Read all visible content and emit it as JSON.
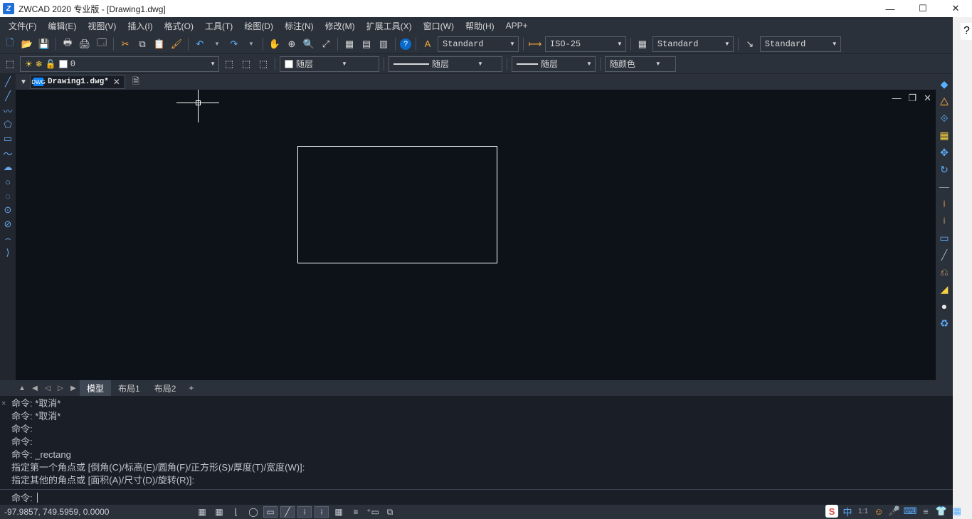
{
  "title": "ZWCAD 2020 专业版 - [Drawing1.dwg]",
  "window": {
    "min": "—",
    "max": "☐",
    "close": "✕"
  },
  "help_hint": "?",
  "menu": [
    "文件(F)",
    "编辑(E)",
    "视图(V)",
    "插入(I)",
    "格式(O)",
    "工具(T)",
    "绘图(D)",
    "标注(N)",
    "修改(M)",
    "扩展工具(X)",
    "窗口(W)",
    "帮助(H)",
    "APP+"
  ],
  "tb1": {
    "new": "🗋",
    "open": "📂",
    "save": "💾",
    "print": "🖶",
    "plot": "🖨",
    "preview": "🗔",
    "cut": "✂",
    "copy": "⧉",
    "paste": "📋",
    "match": "🖌",
    "undo": "↶",
    "redo": "↷",
    "pan": "✋",
    "zoomin": "⊕",
    "zoomwin": "🔍",
    "zoomext": "⤢",
    "grid1": "▦",
    "grid2": "▤",
    "grid3": "▥",
    "help": "?",
    "textstyle_icon": "A",
    "textstyle": "Standard",
    "dimstyle_icon": "⟼",
    "dimstyle": "ISO-25",
    "tablestyle_icon": "▦",
    "tablestyle": "Standard",
    "leader_icon": "↘",
    "leader": "Standard"
  },
  "tb2": {
    "layer_icons": [
      "☀",
      "❄",
      "🔓",
      "▭"
    ],
    "layer_name": "0",
    "layerctl1": "⬚",
    "layerctl2": "⬚",
    "layerctl3": "⬚",
    "color_label": "随层",
    "linetype_label": "随层",
    "lineweight_label": "随层",
    "plotstyle_label": "随颜色"
  },
  "docs": {
    "tabmarker": "▼",
    "tab_icon": "DWG",
    "tab_name": "Drawing1.dwg*",
    "tab_close": "✕",
    "new_icon": "🗎"
  },
  "viewctrl": {
    "min": "—",
    "restore": "❐",
    "close": "✕"
  },
  "left_tools": [
    "╱",
    "╱",
    "〰",
    "⬠",
    "▭",
    "〜",
    "☁",
    "○",
    "◌",
    "⊙",
    "⊘",
    "⌢",
    "⟩"
  ],
  "right_tools": [
    {
      "g": "◆",
      "c": "blue"
    },
    {
      "g": "⧋",
      "c": "orange"
    },
    {
      "g": "⟐",
      "c": "blue"
    },
    {
      "g": "▦",
      "c": "yellow"
    },
    {
      "g": "✥",
      "c": "blue"
    },
    {
      "g": "↻",
      "c": "blue"
    },
    {
      "g": "—",
      "c": "gray"
    },
    {
      "g": "⟊",
      "c": "orange"
    },
    {
      "g": "⟊",
      "c": "tan"
    },
    {
      "g": "▭",
      "c": "blue"
    },
    {
      "g": "╱",
      "c": "gray"
    },
    {
      "g": "⎌",
      "c": "tan"
    },
    {
      "g": "◢",
      "c": "yellow"
    },
    {
      "g": "●",
      "c": "white"
    },
    {
      "g": "♻",
      "c": "blue"
    }
  ],
  "layout": {
    "nav": [
      "▲",
      "◀",
      "◁",
      "▷",
      "▶"
    ],
    "tabs": [
      "模型",
      "布局1",
      "布局2"
    ],
    "add": "+"
  },
  "cmd": {
    "lines": [
      "命令: *取消*",
      "命令: *取消*",
      "命令:",
      "命令:",
      "命令: _rectang",
      "指定第一个角点或 [倒角(C)/标高(E)/圆角(F)/正方形(S)/厚度(T)/宽度(W)]:",
      "指定其他的角点或 [面积(A)/尺寸(D)/旋转(R)]:"
    ],
    "prompt": "命令:",
    "close": "×"
  },
  "status": {
    "coords": "-97.9857, 749.5959, 0.0000",
    "btns": [
      "▦",
      "▦",
      "⌊",
      "◯",
      "▭",
      "╱",
      "⟊",
      "⟊",
      "▦",
      "≡",
      "⁺▭",
      "⧉"
    ],
    "active": [
      4,
      5,
      6,
      7
    ]
  },
  "tray": [
    {
      "g": "S",
      "c": "red"
    },
    {
      "g": "中",
      "c": "blue"
    },
    {
      "g": "⁝",
      "c": "gray"
    },
    {
      "g": "☺",
      "c": "orange"
    },
    {
      "g": "🎤",
      "c": "blue"
    },
    {
      "g": "⌨",
      "c": "blue"
    },
    {
      "g": "≡",
      "c": "gray"
    },
    {
      "g": "👕",
      "c": "cyan"
    },
    {
      "g": "▦",
      "c": "blue"
    }
  ],
  "tray_sep": "1:1"
}
